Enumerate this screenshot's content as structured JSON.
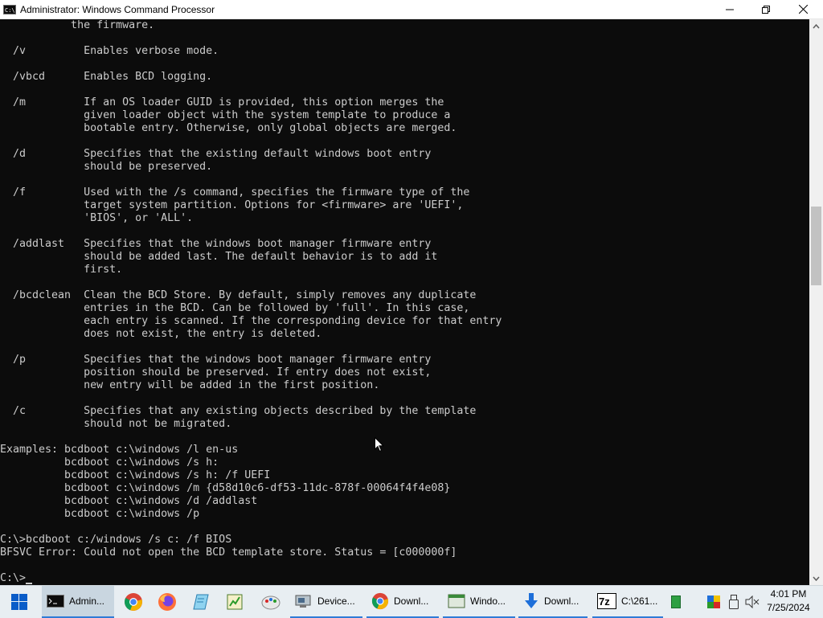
{
  "window": {
    "title": "Administrator: Windows Command Processor",
    "icon_text": "C:\\",
    "controls": [
      "minimize-icon",
      "maximize-icon",
      "close-icon"
    ]
  },
  "console": {
    "lines": [
      "           the firmware.",
      "",
      "  /v         Enables verbose mode.",
      "",
      "  /vbcd      Enables BCD logging.",
      "",
      "  /m         If an OS loader GUID is provided, this option merges the",
      "             given loader object with the system template to produce a",
      "             bootable entry. Otherwise, only global objects are merged.",
      "",
      "  /d         Specifies that the existing default windows boot entry",
      "             should be preserved.",
      "",
      "  /f         Used with the /s command, specifies the firmware type of the",
      "             target system partition. Options for <firmware> are 'UEFI',",
      "             'BIOS', or 'ALL'.",
      "",
      "  /addlast   Specifies that the windows boot manager firmware entry",
      "             should be added last. The default behavior is to add it",
      "             first.",
      "",
      "  /bcdclean  Clean the BCD Store. By default, simply removes any duplicate",
      "             entries in the BCD. Can be followed by 'full'. In this case,",
      "             each entry is scanned. If the corresponding device for that entry",
      "             does not exist, the entry is deleted.",
      "",
      "  /p         Specifies that the windows boot manager firmware entry",
      "             position should be preserved. If entry does not exist,",
      "             new entry will be added in the first position.",
      "",
      "  /c         Specifies that any existing objects described by the template",
      "             should not be migrated.",
      "",
      "Examples: bcdboot c:\\windows /l en-us",
      "          bcdboot c:\\windows /s h:",
      "          bcdboot c:\\windows /s h: /f UEFI",
      "          bcdboot c:\\windows /m {d58d10c6-df53-11dc-878f-00064f4f4e08}",
      "          bcdboot c:\\windows /d /addlast",
      "          bcdboot c:\\windows /p",
      "",
      "C:\\>bcdboot c:/windows /s c: /f BIOS",
      "BFSVC Error: Could not open the BCD template store. Status = [c000000f]",
      ""
    ],
    "prompt": "C:\\>"
  },
  "colors": {
    "console_bg": "#0c0c0c",
    "console_text": "#cccccc",
    "taskbar_bg": "#e8eef2",
    "accent": "#2f7bd6"
  },
  "taskbar": {
    "start_icon": "windows-logo-icon",
    "items": [
      {
        "label": "Admin...",
        "icon": "cmd-icon",
        "active": true
      },
      {
        "label": "",
        "icon": "chrome-icon"
      },
      {
        "label": "",
        "icon": "firefox-icon"
      },
      {
        "label": "",
        "icon": "notepad-icon"
      },
      {
        "label": "",
        "icon": "spreadsheet-icon"
      },
      {
        "label": "",
        "icon": "paint-icon"
      },
      {
        "label": "Device...",
        "icon": "device-manager-icon"
      },
      {
        "label": "Downl...",
        "icon": "chrome-icon"
      },
      {
        "label": "Windo...",
        "icon": "window-icon"
      },
      {
        "label": "Downl...",
        "icon": "download-icon"
      },
      {
        "label": "C:\\261...",
        "icon": "7zip-icon"
      }
    ],
    "tray_icons": [
      "green-app-icon",
      "color-app-icon",
      "usb-icon",
      "volume-muted-icon"
    ],
    "time": "4:01 PM",
    "date": "7/25/2024"
  }
}
